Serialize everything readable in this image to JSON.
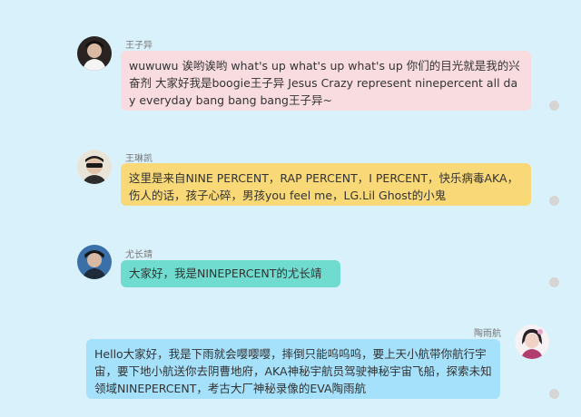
{
  "messages": [
    {
      "sender": "王子异",
      "text": "wuwuwu 诶哟诶哟 what's up what's up what's up 你们的目光就是我的兴奋剂 大家好我是boogie王子异 Jesus Crazy represent ninepercent all day everyday bang bang bang王子异~",
      "bubble_color": "#f8dce0",
      "avatar_icon": "user-avatar-icon"
    },
    {
      "sender": "王琳凯",
      "text": "这里是来自NINE PERCENT，RAP PERCENT，I PERCENT，快乐病毒AKA，伤人的话，孩子心碎，男孩you feel me，LG.Lil Ghost的小鬼",
      "bubble_color": "#f9d977",
      "avatar_icon": "user-avatar-icon"
    },
    {
      "sender": "尤长靖",
      "text": "大家好，我是NINEPERCENT的尤长靖",
      "bubble_color": "#6fdccf",
      "avatar_icon": "user-avatar-icon"
    },
    {
      "sender": "陶雨航",
      "text": "Hello大家好，我是下雨就会嘤嘤嘤，摔倒只能呜呜呜，要上天小航带你航行宇宙，要下地小航送你去阴曹地府，AKA神秘宇航员驾驶神秘宇宙飞船，探索未知领域NINEPERCENT，考古大厂神秘录像的EVA陶雨航",
      "bubble_color": "#a5e1fb",
      "avatar_icon": "user-avatar-icon"
    }
  ]
}
